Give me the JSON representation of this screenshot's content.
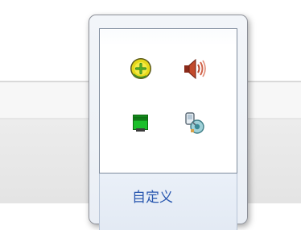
{
  "tray_popup": {
    "icons": [
      {
        "name": "add-circle-icon"
      },
      {
        "name": "speaker-volume-icon"
      },
      {
        "name": "network-status-icon"
      },
      {
        "name": "device-settings-icon"
      }
    ],
    "customize_label": "自定义"
  },
  "colors": {
    "link": "#2a58b0",
    "add_icon_fill": "#e6d81a",
    "network_icon_fill": "#1bbf2a"
  }
}
